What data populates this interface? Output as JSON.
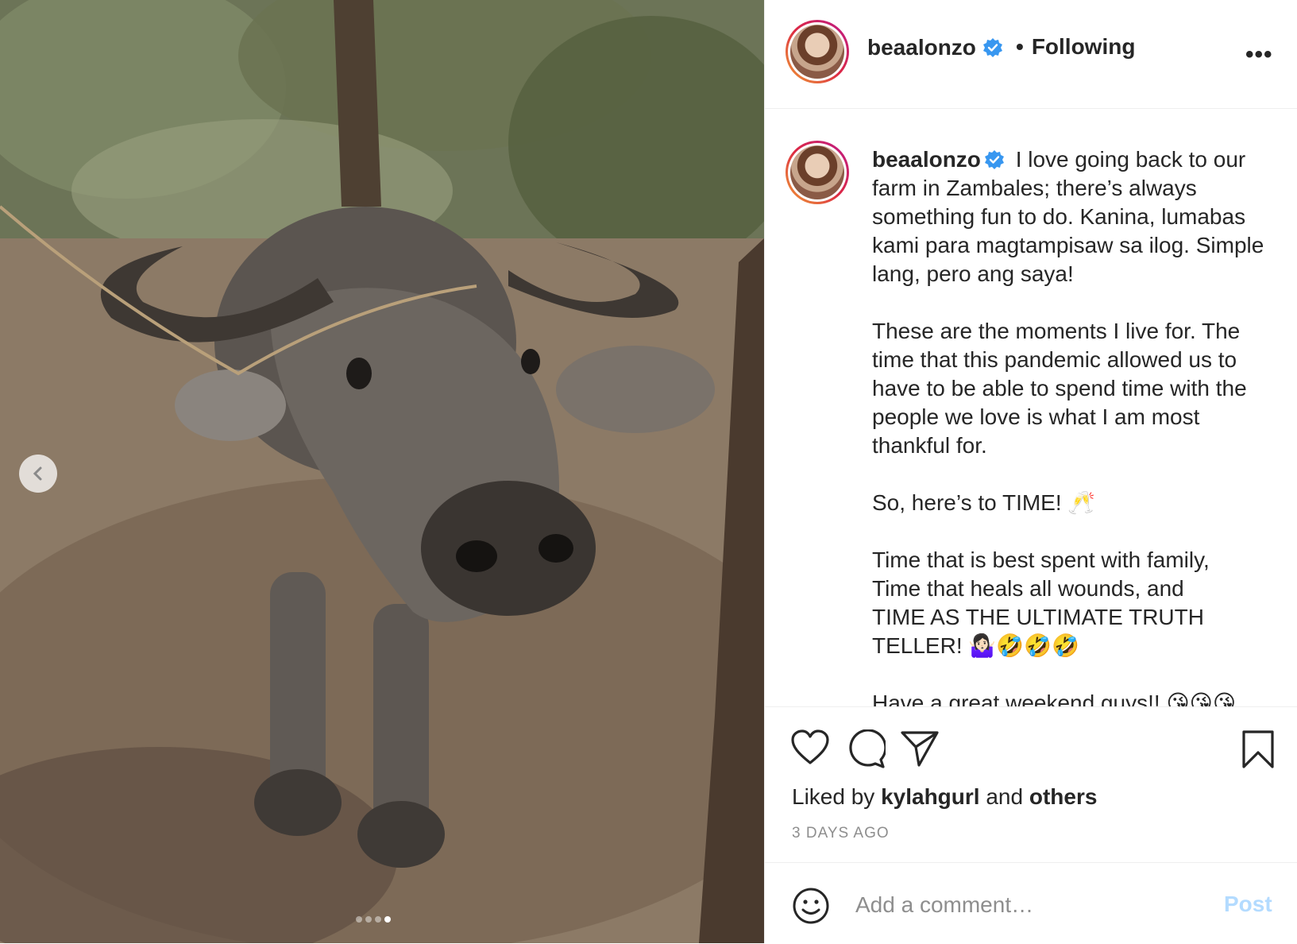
{
  "post": {
    "username": "beaalonzo",
    "follow_separator": "•",
    "follow_status": "Following",
    "more_label": "•••",
    "caption_text": " I love going back to our farm in Zambales; there’s always something fun to do. Kanina, lumabas kami para magtampisaw sa ilog. Simple lang, pero ang saya!\n\nThese are the moments I live for. The time that this pandemic allowed us to have to be able to spend time with the people we love is what I am most thankful for.\n\nSo, here’s to TIME! 🥂\n\nTime that is best spent with family,\nTime that heals all wounds, and\nTIME AS THE ULTIMATE TRUTH TELLER! 🤷🏻‍♀️🤣🤣🤣\n\nHave a great weekend guys!! 😘😘😘",
    "liked_prefix": "Liked by ",
    "liked_user": "kylahgurl",
    "liked_and": " and ",
    "liked_others": "others",
    "date": "3 DAYS AGO"
  },
  "comment": {
    "placeholder": "Add a comment…",
    "post_label": "Post"
  },
  "carousel": {
    "slide_count": 4,
    "active_index": 3
  },
  "colors": {
    "verified": "#3897f0",
    "post_disabled": "#b3dbff",
    "muted": "#8e8e8e"
  },
  "icons": [
    "heart-icon",
    "comment-icon",
    "share-icon",
    "bookmark-icon",
    "emoji-icon",
    "chevron-left-icon",
    "verified-badge-icon",
    "more-icon"
  ]
}
